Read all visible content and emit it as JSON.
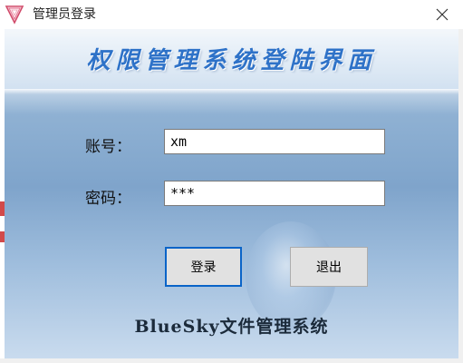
{
  "window": {
    "title": "管理员登录",
    "close_glyph": "✕",
    "icon": "app-logo-icon"
  },
  "banner": {
    "title": "权限管理系统登陆界面"
  },
  "form": {
    "account_label": "账号：",
    "account_value": "xm",
    "password_label": "密码：",
    "password_value": "***"
  },
  "buttons": {
    "login_label": "登录",
    "exit_label": "退出"
  },
  "footer": {
    "text": "BlueSky文件管理系统"
  },
  "colors": {
    "banner_title": "#2e72c8",
    "focus_border": "#0a64c8"
  }
}
